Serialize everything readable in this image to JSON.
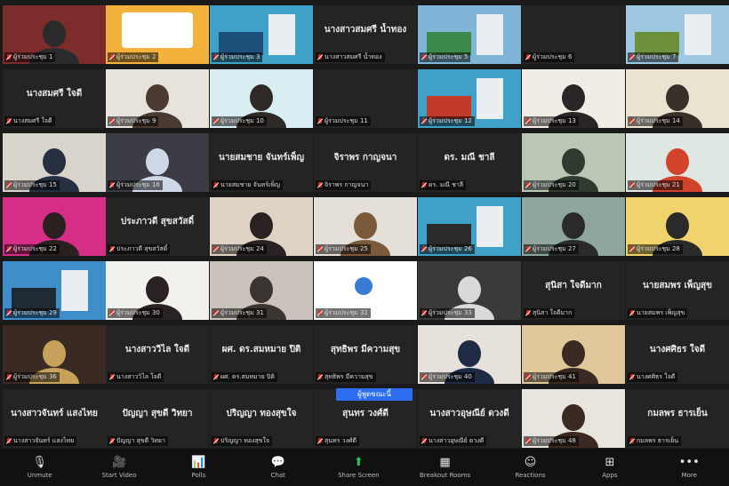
{
  "meeting": {
    "banner_label": "ผู้พูดขณะนี้"
  },
  "tiles": [
    {
      "name": "",
      "label": "ผู้ร่วมประชุม 1",
      "kind": "video",
      "bg": "#7c2c2a",
      "accent": "#2b2b2b",
      "active": true
    },
    {
      "name": "",
      "label": "ผู้ร่วมประชุม 2",
      "kind": "poster",
      "bg": "#f2b23b",
      "accent": "#ffffff"
    },
    {
      "name": "",
      "label": "ผู้ร่วมประชุม 3",
      "kind": "scene",
      "bg": "#3fa0c8",
      "accent": "#1c4f7a"
    },
    {
      "name": "นางสาวสมศรี น้ำทอง",
      "label": "นางสาวสมศรี น้ำทอง",
      "kind": "name"
    },
    {
      "name": "",
      "label": "ผู้ร่วมประชุม 5",
      "kind": "scene",
      "bg": "#7fb6d8",
      "accent": "#3c8a4a"
    },
    {
      "name": "",
      "label": "ผู้ร่วมประชุม 6",
      "kind": "black"
    },
    {
      "name": "",
      "label": "ผู้ร่วมประชุม 7",
      "kind": "scene",
      "bg": "#9ec7e2",
      "accent": "#6b8f3a"
    },
    {
      "name": "นางสมศรี ใจดี",
      "label": "นางสมศรี ใจดี",
      "kind": "name"
    },
    {
      "name": "",
      "label": "ผู้ร่วมประชุม 9",
      "kind": "video",
      "bg": "#e7e2dc",
      "accent": "#4a3a32"
    },
    {
      "name": "",
      "label": "ผู้ร่วมประชุม 10",
      "kind": "video",
      "bg": "#d9eef2",
      "accent": "#2f2a28"
    },
    {
      "name": "",
      "label": "ผู้ร่วมประชุม 11",
      "kind": "black"
    },
    {
      "name": "",
      "label": "ผู้ร่วมประชุม 12",
      "kind": "scene",
      "bg": "#3fa0c8",
      "accent": "#c23a2a"
    },
    {
      "name": "",
      "label": "ผู้ร่วมประชุม 13",
      "kind": "video",
      "bg": "#f1ece6",
      "accent": "#2a2626"
    },
    {
      "name": "",
      "label": "ผู้ร่วมประชุม 14",
      "kind": "video",
      "bg": "#e9e3cf",
      "accent": "#3a302a"
    },
    {
      "name": "",
      "label": "ผู้ร่วมประชุม 15",
      "kind": "video",
      "bg": "#d8d4cc",
      "accent": "#273040"
    },
    {
      "name": "",
      "label": "ผู้ร่วมประชุม 16",
      "kind": "video",
      "bg": "#3c3c44",
      "accent": "#cfd8e6"
    },
    {
      "name": "นายสมชาย จันทร์เพ็ญ",
      "label": "นายสมชาย จันทร์เพ็ญ",
      "kind": "name"
    },
    {
      "name": "จิราพร กาญจนา",
      "label": "จิราพร กาญจนา",
      "kind": "name"
    },
    {
      "name": "ดร. มณี ชาลี",
      "label": "ดร. มณี ชาลี",
      "kind": "name"
    },
    {
      "name": "",
      "label": "ผู้ร่วมประชุม 20",
      "kind": "video",
      "bg": "#b9c7b4",
      "accent": "#2e3b2e"
    },
    {
      "name": "",
      "label": "ผู้ร่วมประชุม 21",
      "kind": "video",
      "bg": "#dfe7e4",
      "accent": "#d2432b"
    },
    {
      "name": "",
      "label": "ผู้ร่วมประชุม 22",
      "kind": "video",
      "bg": "#d62d86",
      "accent": "#2a2020"
    },
    {
      "name": "ประภาวดี สุขสวัสดิ์",
      "label": "ประภาวดี สุขสวัสดิ์",
      "kind": "name"
    },
    {
      "name": "",
      "label": "ผู้ร่วมประชุม 24",
      "kind": "video",
      "bg": "#ded3c4",
      "accent": "#2a2222"
    },
    {
      "name": "",
      "label": "ผู้ร่วมประชุม 25",
      "kind": "video",
      "bg": "#e4dfd8",
      "accent": "#7a5a3a"
    },
    {
      "name": "",
      "label": "ผู้ร่วมประชุม 26",
      "kind": "scene",
      "bg": "#3fa0c8",
      "accent": "#2a2a2a"
    },
    {
      "name": "",
      "label": "ผู้ร่วมประชุม 27",
      "kind": "video",
      "bg": "#8fa6a0",
      "accent": "#2a2a2a"
    },
    {
      "name": "",
      "label": "ผู้ร่วมประชุม 28",
      "kind": "video",
      "bg": "#f0d36a",
      "accent": "#2a2a2a"
    },
    {
      "name": "",
      "label": "ผู้ร่วมประชุม 29",
      "kind": "scene",
      "bg": "#3d8ec9",
      "accent": "#1f2a33"
    },
    {
      "name": "",
      "label": "ผู้ร่วมประชุม 30",
      "kind": "video",
      "bg": "#f3f1ee",
      "accent": "#2a2222"
    },
    {
      "name": "",
      "label": "ผู้ร่วมประชุม 31",
      "kind": "video",
      "bg": "#c9c3bb",
      "accent": "#3a3530"
    },
    {
      "name": "",
      "label": "ผู้ร่วมประชุม 32",
      "kind": "logo",
      "bg": "#ffffff",
      "accent": "#3a7bd5"
    },
    {
      "name": "",
      "label": "ผู้ร่วมประชุม 33",
      "kind": "video",
      "bg": "#3a3a3a",
      "accent": "#d9d9d9"
    },
    {
      "name": "สุนิสา ใจดีมาก",
      "label": "สุนิสา ใจดีมาก",
      "kind": "name"
    },
    {
      "name": "นายสมพร เพ็ญสุข",
      "label": "นายสมพร เพ็ญสุข",
      "kind": "name"
    },
    {
      "name": "",
      "label": "ผู้ร่วมประชุม 36",
      "kind": "video",
      "bg": "#3a2a24",
      "accent": "#c6a25a"
    },
    {
      "name": "นางสาววิไล ใจดี",
      "label": "นางสาววิไล ใจดี",
      "kind": "name"
    },
    {
      "name": "ผศ. ดร.สมหมาย ปิติ",
      "label": "ผศ. ดร.สมหมาย ปิติ",
      "kind": "name"
    },
    {
      "name": "สุทธิพร มีความสุข",
      "label": "สุทธิพร มีความสุข",
      "kind": "name"
    },
    {
      "name": "",
      "label": "ผู้ร่วมประชุม 40",
      "kind": "video",
      "bg": "#e6e1db",
      "accent": "#1f2a44"
    },
    {
      "name": "",
      "label": "ผู้ร่วมประชุม 41",
      "kind": "video",
      "bg": "#e0c89a",
      "accent": "#3a2a22"
    },
    {
      "name": "นางศศิธร ใจดี",
      "label": "นางศศิธร ใจดี",
      "kind": "name"
    },
    {
      "name": "นางสาวจันทร์ แสงไทย",
      "label": "นางสาวจันทร์ แสงไทย",
      "kind": "name"
    },
    {
      "name": "ปัญญา สุขดี วิทยา",
      "label": "ปัญญา สุขดี วิทยา",
      "kind": "name"
    },
    {
      "name": "ปริญญา ทองสุขใจ",
      "label": "ปริญญา ทองสุขใจ",
      "kind": "name"
    },
    {
      "name": "สุนทร วงศ์ดี",
      "label": "สุนทร วงศ์ดี",
      "kind": "name"
    },
    {
      "name": "นางสาวอุษณีย์ ดวงดี",
      "label": "นางสาวอุษณีย์ ดวงดี",
      "kind": "name"
    },
    {
      "name": "",
      "label": "ผู้ร่วมประชุม 48",
      "kind": "video",
      "bg": "#e8e4de",
      "accent": "#3a2a22"
    },
    {
      "name": "กมลพร ธารเย็น",
      "label": "กมลพร ธารเย็น",
      "kind": "name"
    }
  ],
  "toolbar": [
    {
      "label": "Unmute",
      "icon": "🎙",
      "icon_name": "microphone-icon",
      "green": false
    },
    {
      "label": "Start Video",
      "icon": "🎥",
      "icon_name": "video-camera-icon",
      "green": false
    },
    {
      "label": "Polls",
      "icon": "📊",
      "icon_name": "polls-icon",
      "green": false
    },
    {
      "label": "Chat",
      "icon": "💬",
      "icon_name": "chat-icon",
      "green": false
    },
    {
      "label": "Share Screen",
      "icon": "⬆",
      "icon_name": "share-screen-icon",
      "green": true
    },
    {
      "label": "Breakout Rooms",
      "icon": "▦",
      "icon_name": "breakout-rooms-icon",
      "green": false
    },
    {
      "label": "Reactions",
      "icon": "☺",
      "icon_name": "reactions-icon",
      "green": false
    },
    {
      "label": "Apps",
      "icon": "⊞",
      "icon_name": "apps-icon",
      "green": false
    },
    {
      "label": "More",
      "icon": "•••",
      "icon_name": "more-icon",
      "green": false
    }
  ]
}
